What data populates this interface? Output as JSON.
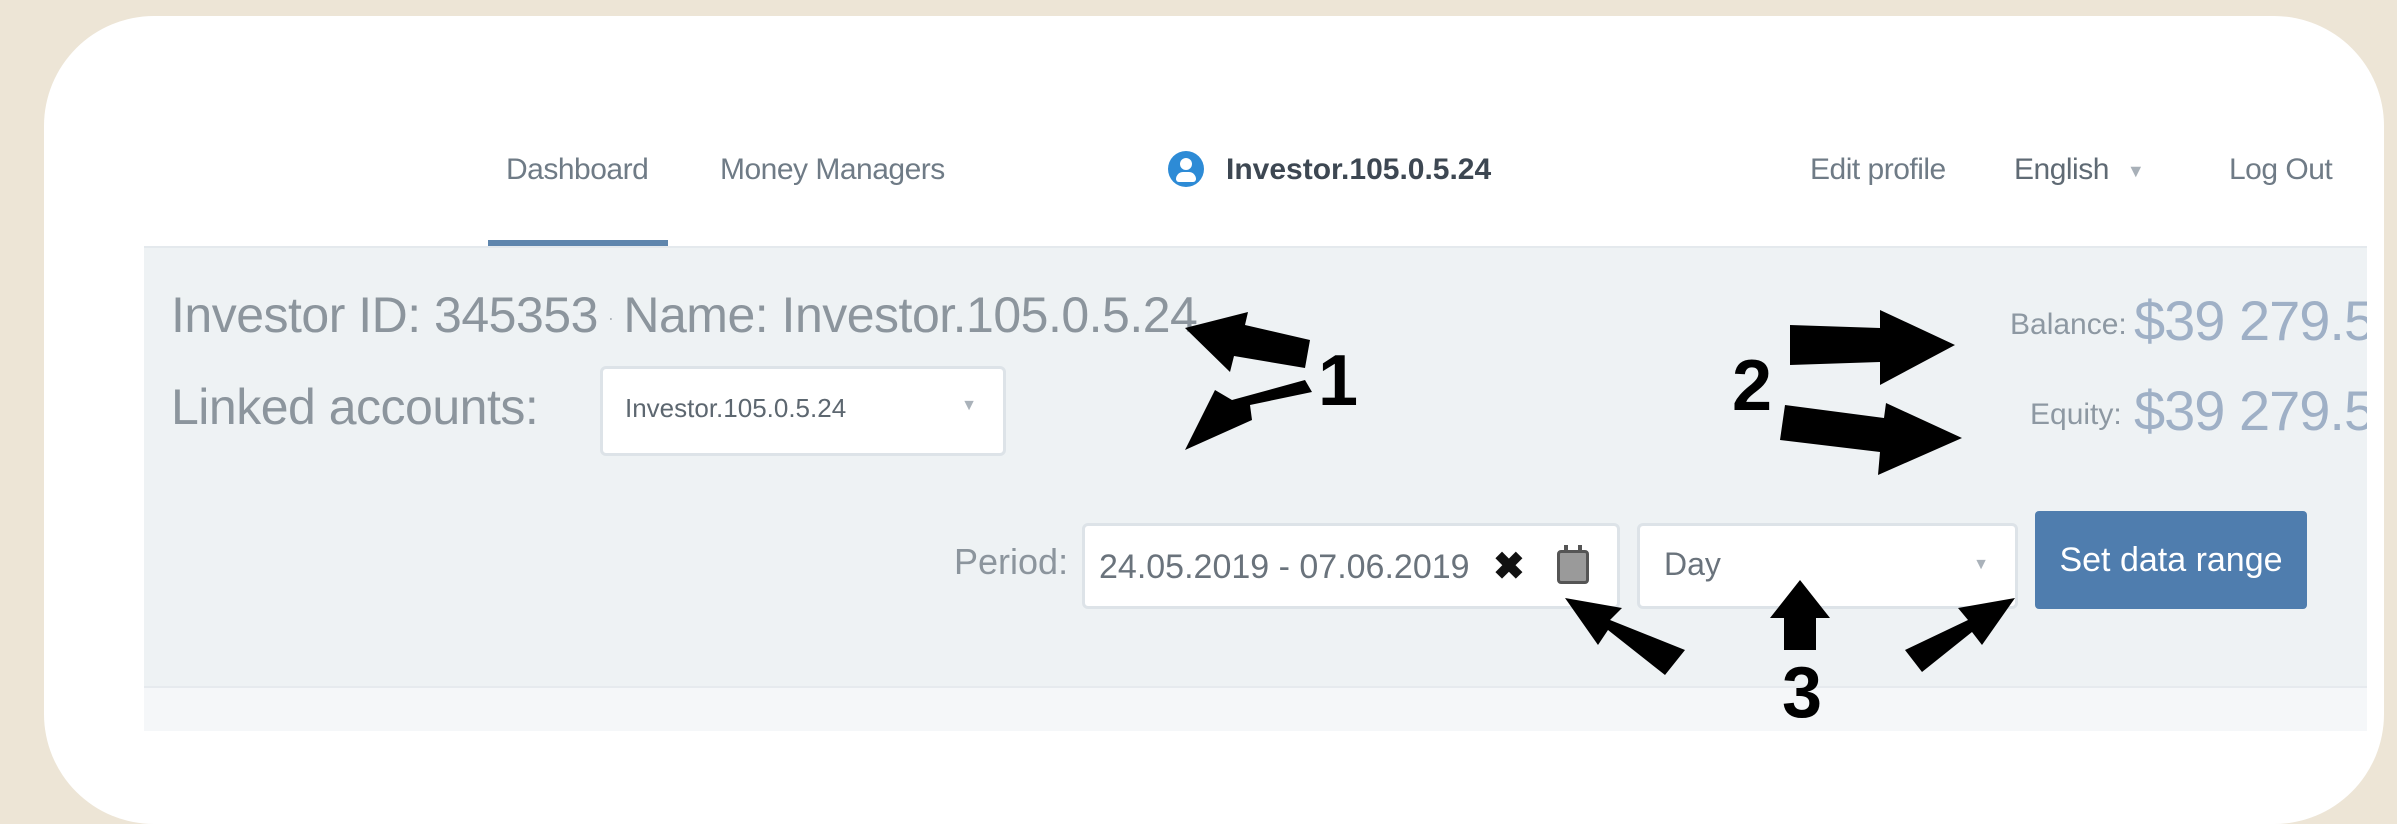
{
  "nav": {
    "links": [
      "Dashboard",
      "Money Managers"
    ],
    "user_name": "Investor.105.0.5.24",
    "edit_profile": "Edit profile",
    "language": "English",
    "logout": "Log Out"
  },
  "account": {
    "investor_id_text": "Investor ID: 345353",
    "separator": "·",
    "name_text": "Name: Investor.105.0.5.24",
    "linked_label": "Linked accounts:",
    "linked_value": "Investor.105.0.5.24"
  },
  "balance": {
    "balance_label": "Balance:",
    "balance_value": "$39 279.5",
    "equity_label": "Equity:",
    "equity_value": "$39 279.5"
  },
  "filters": {
    "period_label": "Period:",
    "date_range": "24.05.2019 - 07.06.2019",
    "granularity": "Day",
    "set_button": "Set data range"
  },
  "annotations": {
    "markers": [
      "1",
      "2",
      "3"
    ],
    "arrow_color": "#000000"
  },
  "colors": {
    "accent": "#4f7dae",
    "panel_bg": "#eef2f4",
    "frame_bg": "#ede5d6"
  }
}
